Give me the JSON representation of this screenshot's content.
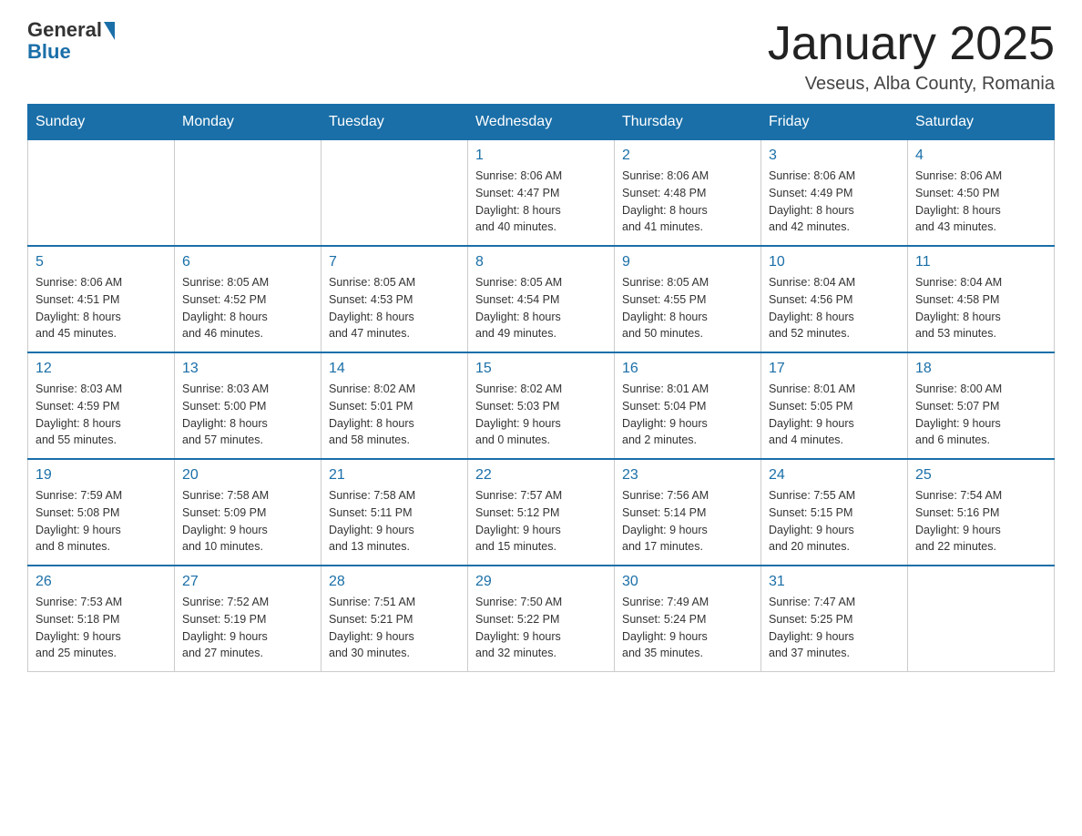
{
  "header": {
    "logo_general": "General",
    "logo_blue": "Blue",
    "month_title": "January 2025",
    "location": "Veseus, Alba County, Romania"
  },
  "weekdays": [
    "Sunday",
    "Monday",
    "Tuesday",
    "Wednesday",
    "Thursday",
    "Friday",
    "Saturday"
  ],
  "weeks": [
    {
      "days": [
        {
          "num": "",
          "info": ""
        },
        {
          "num": "",
          "info": ""
        },
        {
          "num": "",
          "info": ""
        },
        {
          "num": "1",
          "info": "Sunrise: 8:06 AM\nSunset: 4:47 PM\nDaylight: 8 hours\nand 40 minutes."
        },
        {
          "num": "2",
          "info": "Sunrise: 8:06 AM\nSunset: 4:48 PM\nDaylight: 8 hours\nand 41 minutes."
        },
        {
          "num": "3",
          "info": "Sunrise: 8:06 AM\nSunset: 4:49 PM\nDaylight: 8 hours\nand 42 minutes."
        },
        {
          "num": "4",
          "info": "Sunrise: 8:06 AM\nSunset: 4:50 PM\nDaylight: 8 hours\nand 43 minutes."
        }
      ]
    },
    {
      "days": [
        {
          "num": "5",
          "info": "Sunrise: 8:06 AM\nSunset: 4:51 PM\nDaylight: 8 hours\nand 45 minutes."
        },
        {
          "num": "6",
          "info": "Sunrise: 8:05 AM\nSunset: 4:52 PM\nDaylight: 8 hours\nand 46 minutes."
        },
        {
          "num": "7",
          "info": "Sunrise: 8:05 AM\nSunset: 4:53 PM\nDaylight: 8 hours\nand 47 minutes."
        },
        {
          "num": "8",
          "info": "Sunrise: 8:05 AM\nSunset: 4:54 PM\nDaylight: 8 hours\nand 49 minutes."
        },
        {
          "num": "9",
          "info": "Sunrise: 8:05 AM\nSunset: 4:55 PM\nDaylight: 8 hours\nand 50 minutes."
        },
        {
          "num": "10",
          "info": "Sunrise: 8:04 AM\nSunset: 4:56 PM\nDaylight: 8 hours\nand 52 minutes."
        },
        {
          "num": "11",
          "info": "Sunrise: 8:04 AM\nSunset: 4:58 PM\nDaylight: 8 hours\nand 53 minutes."
        }
      ]
    },
    {
      "days": [
        {
          "num": "12",
          "info": "Sunrise: 8:03 AM\nSunset: 4:59 PM\nDaylight: 8 hours\nand 55 minutes."
        },
        {
          "num": "13",
          "info": "Sunrise: 8:03 AM\nSunset: 5:00 PM\nDaylight: 8 hours\nand 57 minutes."
        },
        {
          "num": "14",
          "info": "Sunrise: 8:02 AM\nSunset: 5:01 PM\nDaylight: 8 hours\nand 58 minutes."
        },
        {
          "num": "15",
          "info": "Sunrise: 8:02 AM\nSunset: 5:03 PM\nDaylight: 9 hours\nand 0 minutes."
        },
        {
          "num": "16",
          "info": "Sunrise: 8:01 AM\nSunset: 5:04 PM\nDaylight: 9 hours\nand 2 minutes."
        },
        {
          "num": "17",
          "info": "Sunrise: 8:01 AM\nSunset: 5:05 PM\nDaylight: 9 hours\nand 4 minutes."
        },
        {
          "num": "18",
          "info": "Sunrise: 8:00 AM\nSunset: 5:07 PM\nDaylight: 9 hours\nand 6 minutes."
        }
      ]
    },
    {
      "days": [
        {
          "num": "19",
          "info": "Sunrise: 7:59 AM\nSunset: 5:08 PM\nDaylight: 9 hours\nand 8 minutes."
        },
        {
          "num": "20",
          "info": "Sunrise: 7:58 AM\nSunset: 5:09 PM\nDaylight: 9 hours\nand 10 minutes."
        },
        {
          "num": "21",
          "info": "Sunrise: 7:58 AM\nSunset: 5:11 PM\nDaylight: 9 hours\nand 13 minutes."
        },
        {
          "num": "22",
          "info": "Sunrise: 7:57 AM\nSunset: 5:12 PM\nDaylight: 9 hours\nand 15 minutes."
        },
        {
          "num": "23",
          "info": "Sunrise: 7:56 AM\nSunset: 5:14 PM\nDaylight: 9 hours\nand 17 minutes."
        },
        {
          "num": "24",
          "info": "Sunrise: 7:55 AM\nSunset: 5:15 PM\nDaylight: 9 hours\nand 20 minutes."
        },
        {
          "num": "25",
          "info": "Sunrise: 7:54 AM\nSunset: 5:16 PM\nDaylight: 9 hours\nand 22 minutes."
        }
      ]
    },
    {
      "days": [
        {
          "num": "26",
          "info": "Sunrise: 7:53 AM\nSunset: 5:18 PM\nDaylight: 9 hours\nand 25 minutes."
        },
        {
          "num": "27",
          "info": "Sunrise: 7:52 AM\nSunset: 5:19 PM\nDaylight: 9 hours\nand 27 minutes."
        },
        {
          "num": "28",
          "info": "Sunrise: 7:51 AM\nSunset: 5:21 PM\nDaylight: 9 hours\nand 30 minutes."
        },
        {
          "num": "29",
          "info": "Sunrise: 7:50 AM\nSunset: 5:22 PM\nDaylight: 9 hours\nand 32 minutes."
        },
        {
          "num": "30",
          "info": "Sunrise: 7:49 AM\nSunset: 5:24 PM\nDaylight: 9 hours\nand 35 minutes."
        },
        {
          "num": "31",
          "info": "Sunrise: 7:47 AM\nSunset: 5:25 PM\nDaylight: 9 hours\nand 37 minutes."
        },
        {
          "num": "",
          "info": ""
        }
      ]
    }
  ]
}
